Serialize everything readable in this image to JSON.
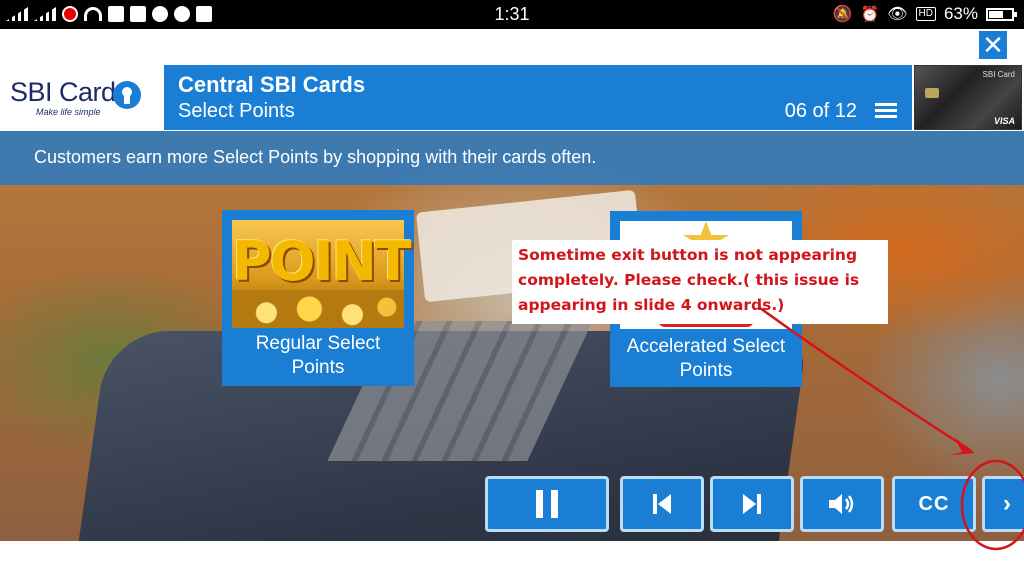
{
  "status_bar": {
    "time": "1:31",
    "battery": "63%",
    "battery_level": 0.63,
    "hd_badge": "HD"
  },
  "close_label": "✕",
  "logo": {
    "name": "SBI Card",
    "tagline": "Make life simple"
  },
  "header": {
    "title": "Central SBI Cards",
    "subtitle": "Select Points",
    "slide_counter": "06 of 12"
  },
  "card_thumb": {
    "brand": "SBI Card",
    "network": "VISA"
  },
  "banner": {
    "text": "Customers earn more Select Points by shopping with their cards often."
  },
  "tiles": [
    {
      "label_line1": "Regular Select",
      "label_line2": "Points",
      "image_word": "POINT"
    },
    {
      "label_line1": "Accelerated Select",
      "label_line2": "Points"
    }
  ],
  "annotation": {
    "line1": "Sometime exit button is not appearing",
    "line2": "completely. Please check.( this issue is",
    "line3": "appearing in slide 4 onwards.)"
  },
  "controls": {
    "cc_label": "CC",
    "next_peek": "›"
  },
  "colors": {
    "accent": "#1a7fd4",
    "annotation_red": "#d3141b"
  }
}
